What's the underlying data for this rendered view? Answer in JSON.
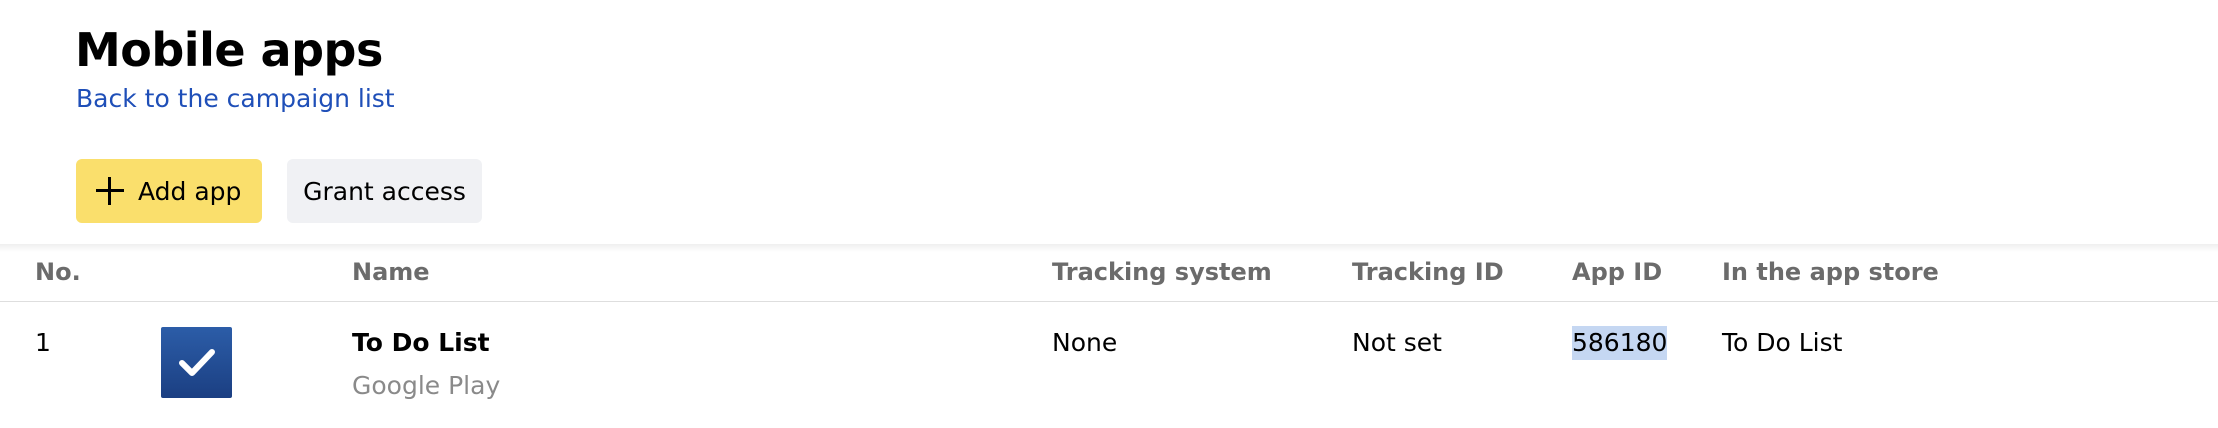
{
  "header": {
    "title": "Mobile apps",
    "back_link": "Back to the campaign list"
  },
  "toolbar": {
    "add_app_label": "Add app",
    "grant_access_label": "Grant access"
  },
  "colors": {
    "accent_button": "#fadf6c",
    "secondary_button": "#f0f1f4",
    "link": "#1f4fb8",
    "app_icon": "#1b3f82",
    "selection": "#c5d7f2"
  },
  "table": {
    "columns": {
      "no": "No.",
      "icon": "",
      "name": "Name",
      "tracking_system": "Tracking system",
      "tracking_id": "Tracking ID",
      "app_id": "App ID",
      "app_store": "In the app store"
    },
    "rows": [
      {
        "no": "1",
        "icon": "checkmark-app-icon",
        "name": "To Do List",
        "store": "Google Play",
        "tracking_system": "None",
        "tracking_id": "Not set",
        "app_id": "586180",
        "app_store_name": "To Do List"
      }
    ]
  }
}
